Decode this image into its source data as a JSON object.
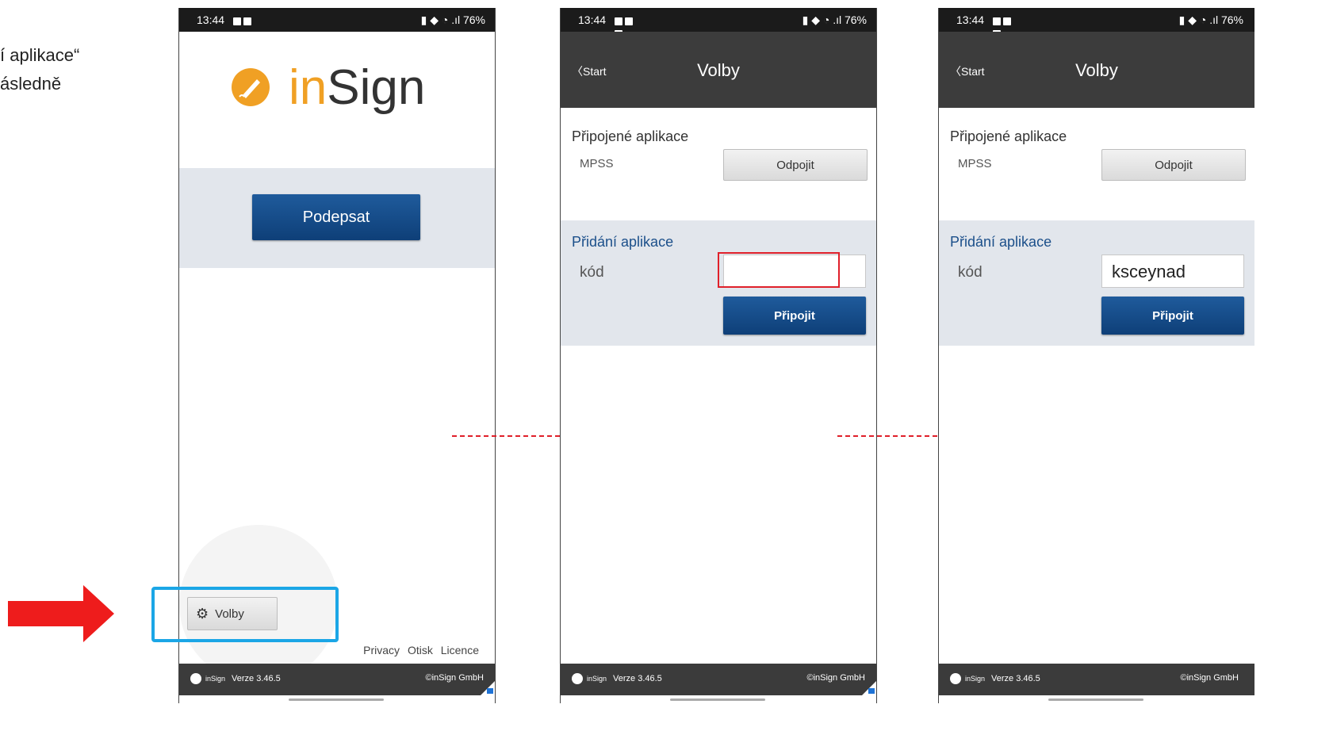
{
  "instruction": {
    "line1": "í aplikace“",
    "line2": "ásledně"
  },
  "status_bar": {
    "time": "13:44",
    "battery": "76%"
  },
  "screen1": {
    "logo_prefix": "in",
    "logo_suffix": "Sign",
    "sign_button": "Podepsat",
    "settings_button": "Volby",
    "footer_links": [
      "Privacy",
      "Otisk",
      "Licence"
    ]
  },
  "settings_screen": {
    "back_label": "Start",
    "title": "Volby",
    "connected_title": "Připojené aplikace",
    "connected_app": "MPSS",
    "disconnect_button": "Odpojit",
    "add_title": "Přidání aplikace",
    "code_label": "kód",
    "connect_button": "Připojit"
  },
  "screen2": {
    "code_value": ""
  },
  "screen3": {
    "code_value": "ksceynad"
  },
  "footer": {
    "brand": "inSign",
    "version": "Verze 3.46.5",
    "copyright": "©inSign GmbH"
  },
  "colors": {
    "primary_button": "#0e3f78",
    "logo_orange": "#f0a024",
    "highlight_red": "#e0202a",
    "highlight_blue": "#1ba6e6",
    "arrow_red": "#ee1c1c"
  }
}
